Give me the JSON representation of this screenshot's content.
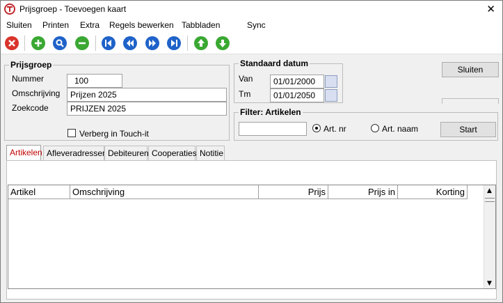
{
  "window": {
    "title": "Prijsgroep - Toevoegen kaart"
  },
  "menu": [
    {
      "label": "Sluiten"
    },
    {
      "label": "Printen"
    },
    {
      "label": "Extra"
    },
    {
      "label": "Regels bewerken"
    },
    {
      "label": "Tabbladen"
    },
    {
      "label": "Sync"
    }
  ],
  "toolbar": {
    "colors": {
      "close": "#d9342b",
      "green": "#3aa832",
      "blue": "#1f62c9"
    }
  },
  "prijsgroep": {
    "title": "Prijsgroep",
    "nummer_label": "Nummer",
    "nummer_value": "100",
    "omschrijving_label": "Omschrijving",
    "omschrijving_value": "Prijzen 2025",
    "zoekcode_label": "Zoekcode",
    "zoekcode_value": "PRIJZEN 2025",
    "verberg_label": "Verberg in Touch-it"
  },
  "standaard_datum": {
    "title": "Standaard datum",
    "van_label": "Van",
    "van_value": "01/01/2000",
    "tm_label": "Tm",
    "tm_value": "01/01/2050"
  },
  "sluiten_button": "Sluiten",
  "filter": {
    "title": "Filter: Artikelen",
    "search_value": "",
    "radio_artnr": "Art. nr",
    "radio_artnaam": "Art. naam",
    "start_button": "Start"
  },
  "tabs": [
    {
      "label": "Artikelen"
    },
    {
      "label": "Afleveradressen"
    },
    {
      "label": "Debiteuren"
    },
    {
      "label": "Cooperaties"
    },
    {
      "label": "Notitie"
    }
  ],
  "grid": {
    "columns": [
      "Artikel",
      "Omschrijving",
      "Prijs",
      "Prijs in",
      "Korting"
    ]
  }
}
